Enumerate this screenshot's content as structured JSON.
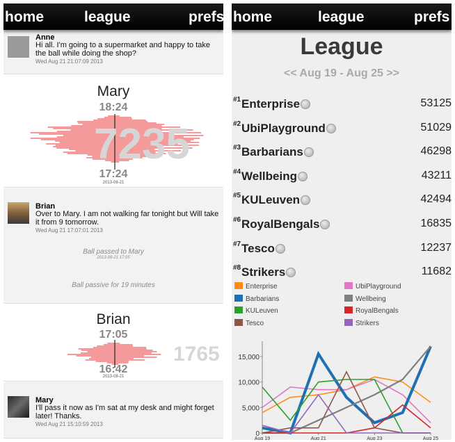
{
  "nav": {
    "home": "home",
    "league": "league",
    "prefs": "prefs"
  },
  "feed": {
    "messages": [
      {
        "author": "Anne",
        "text": "Hi all. I'm going to a supermarket and happy to take the ball while doing the shop?",
        "stamp": "Wed Aug 21 21:07:09 2013"
      },
      {
        "author": "Brian",
        "text": "Over to Mary. I am not walking far tonight but Will take it from 9 tomorrow.",
        "stamp": "Wed Aug 21 17:07:01 2013"
      },
      {
        "author": "Mary",
        "text": "I'll pass it now as I'm sat at my desk and might forget later! Thanks.",
        "stamp": "Wed Aug 21 15:10:59 2013"
      }
    ],
    "batons": [
      {
        "name": "Mary",
        "start": "18:24",
        "end": "17:24",
        "date": "2013-08-21",
        "steps": "7235"
      },
      {
        "name": "Brian",
        "start": "17:05",
        "end": "16:42",
        "date": "2013-08-21",
        "steps": "1765"
      }
    ],
    "events": [
      {
        "text": "Ball passed to Mary",
        "date": "2013-08-21 17:05"
      },
      {
        "text": "Ball passive for 19 minutes",
        "date": ""
      }
    ]
  },
  "league": {
    "title": "League",
    "prev": "<<",
    "week": "Aug 19 - Aug 25",
    "next": ">>",
    "rows": [
      {
        "rank": "#1",
        "team": "Enterprise",
        "score": "53125"
      },
      {
        "rank": "#2",
        "team": "UbiPlayground",
        "score": "51029"
      },
      {
        "rank": "#3",
        "team": "Barbarians",
        "score": "46298"
      },
      {
        "rank": "#4",
        "team": "Wellbeing",
        "score": "43211"
      },
      {
        "rank": "#5",
        "team": "KULeuven",
        "score": "42494"
      },
      {
        "rank": "#6",
        "team": "RoyalBengals",
        "score": "16835"
      },
      {
        "rank": "#7",
        "team": "Tesco",
        "score": "12237"
      },
      {
        "rank": "#8",
        "team": "Strikers",
        "score": "11682"
      }
    ],
    "legend": [
      {
        "name": "Enterprise",
        "color": "#ff8c1a"
      },
      {
        "name": "UbiPlayground",
        "color": "#e377c2"
      },
      {
        "name": "Barbarians",
        "color": "#1f6fb5"
      },
      {
        "name": "Wellbeing",
        "color": "#7f7f7f"
      },
      {
        "name": "KULeuven",
        "color": "#2ca02c"
      },
      {
        "name": "RoyalBengals",
        "color": "#d62728"
      },
      {
        "name": "Tesco",
        "color": "#8c564b"
      },
      {
        "name": "Strikers",
        "color": "#9467bd"
      }
    ]
  },
  "chart_data": {
    "type": "line",
    "x": [
      "Aug 19",
      "Aug 20",
      "Aug 21",
      "Aug 22",
      "Aug 23",
      "Aug 24",
      "Aug 25"
    ],
    "xticks": [
      "Aug 19",
      "Aug 21",
      "Aug 23",
      "Aug 25"
    ],
    "yticks": [
      "0",
      "5,000",
      "10,000",
      "15,000"
    ],
    "ylim": [
      0,
      18000
    ],
    "series": [
      {
        "name": "Enterprise",
        "color": "#ff8c1a",
        "values": [
          4000,
          7000,
          7500,
          8500,
          11000,
          10000,
          6000
        ]
      },
      {
        "name": "UbiPlayground",
        "color": "#e377c2",
        "values": [
          5000,
          9000,
          8500,
          8500,
          10500,
          7500,
          2000
        ]
      },
      {
        "name": "Barbarians",
        "color": "#1f6fb5",
        "values": [
          1000,
          0,
          15500,
          7000,
          2000,
          4000,
          17000
        ]
      },
      {
        "name": "Wellbeing",
        "color": "#7f7f7f",
        "values": [
          0,
          0,
          2500,
          5000,
          7500,
          10500,
          17000
        ]
      },
      {
        "name": "KULeuven",
        "color": "#2ca02c",
        "values": [
          9000,
          2500,
          10000,
          10500,
          10500,
          0,
          0
        ]
      },
      {
        "name": "RoyalBengals",
        "color": "#d62728",
        "values": [
          0,
          0,
          0,
          0,
          1000,
          5500,
          1000
        ]
      },
      {
        "name": "Tesco",
        "color": "#8c564b",
        "values": [
          0,
          1000,
          1000,
          12000,
          1000,
          0,
          0
        ]
      },
      {
        "name": "Strikers",
        "color": "#9467bd",
        "values": [
          1500,
          0,
          7500,
          0,
          0,
          0,
          0
        ]
      }
    ]
  }
}
